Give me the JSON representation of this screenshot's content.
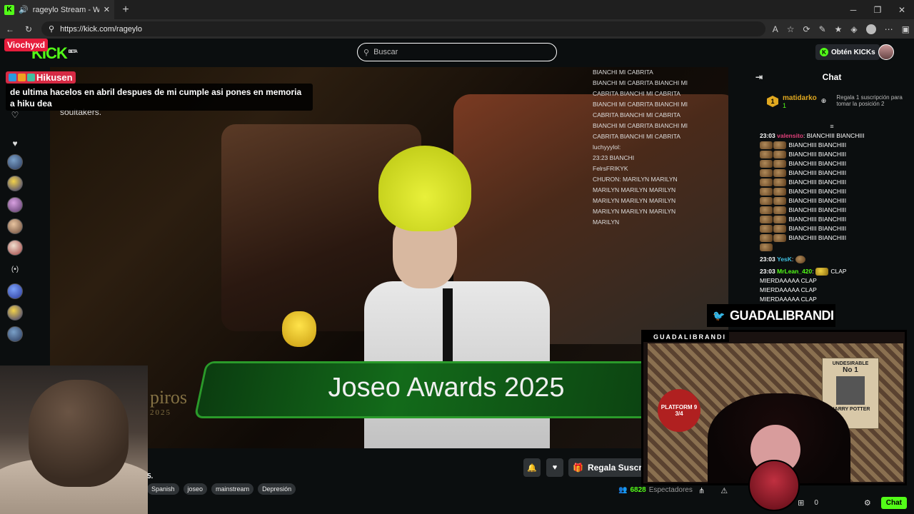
{
  "browser": {
    "tab_title": "rageylo Stream - Watch Live o",
    "url": "https://kick.com/rageylo",
    "new_tab": "+",
    "favicon": "K"
  },
  "header": {
    "logo": "KICK",
    "logo_badge": "BETA",
    "search_placeholder": "Buscar",
    "kicks_button": "Obtén KICKs"
  },
  "overlay": {
    "user1": "Viochyxd",
    "user2": "Hikusen",
    "message": "de ultima hacelos en abril despues de mi cumple asi pones en memoria a hiku dea",
    "soultakers": "soultakers.",
    "banner": "Joseo Awards 2025",
    "award_bg": "piros",
    "award_year": "2025",
    "twitter_handle": "GUADALIBRANDI",
    "facecam_label": "GUADALIBRANDI",
    "poster_title": "UNDESIRABLE",
    "poster_no": "No 1",
    "poster_name": "HARRY POTTER",
    "platform": "PLATFORM 9 3/4",
    "chat_lines": [
      "BIANCHI MI CABRITA",
      "BIANCHI MI CABRITA BIANCHI MI",
      "CABRITA BIANCHI MI CABRITA",
      "BIANCHI MI CABRITA BIANCHI MI",
      "CABRITA BIANCHI MI CABRITA",
      "BIANCHI MI CABRITA BIANCHI MI",
      "CABRITA BIANCHI MI CABRITA",
      "luchyyylol:",
      "23:23 BIANCHI",
      "",
      "",
      "FelrsFRIKYK",
      "CHURON: MARILYN MARILYN",
      "MARILYN MARILYN MARILYN",
      "MARILYN MARILYN MARILYN",
      "MARILYN MARILYN MARILYN",
      "MARILYN"
    ]
  },
  "stream": {
    "title_tail": "5.",
    "tags": [
      "Spanish",
      "joseo",
      "mainstream",
      "Depresión"
    ],
    "gift_button": "Regala Suscrip",
    "viewers_count": "6828",
    "viewers_label": "Espectadores"
  },
  "chat": {
    "title": "Chat",
    "pinned_user": "matidarko",
    "pinned_rank": "1",
    "pinned_count": "1",
    "pinned_gift": "Regala 1 suscripción para tomar la posición 2",
    "messages": [
      {
        "time": "23:03",
        "user": "valensito",
        "text": "BIANCHIII BIANCHIII"
      },
      {
        "time": "",
        "user": "",
        "text": "BIANCHIII BIANCHIII"
      },
      {
        "time": "",
        "user": "",
        "text": "BIANCHIII BIANCHIII"
      },
      {
        "time": "",
        "user": "",
        "text": "BIANCHIII BIANCHIII"
      },
      {
        "time": "",
        "user": "",
        "text": "BIANCHIII BIANCHIII"
      },
      {
        "time": "",
        "user": "",
        "text": "BIANCHIII BIANCHIII"
      },
      {
        "time": "",
        "user": "",
        "text": "BIANCHIII BIANCHIII"
      },
      {
        "time": "",
        "user": "",
        "text": "BIANCHIII BIANCHIII"
      },
      {
        "time": "",
        "user": "",
        "text": "BIANCHIII BIANCHIII"
      },
      {
        "time": "",
        "user": "",
        "text": "BIANCHIII BIANCHIII"
      },
      {
        "time": "",
        "user": "",
        "text": "BIANCHIII BIANCHIII"
      },
      {
        "time": "",
        "user": "",
        "text": "BIANCHIII BIANCHIII"
      }
    ],
    "msg2_time": "23:03",
    "msg2_user": "YesK",
    "msg3_time": "23:03",
    "msg3_user": "MrLean_420",
    "msg3_lines": [
      "CLAP",
      "MIERDAAAAA CLAP",
      "MIERDAAAAA CLAP",
      "MIERDAAAAA CLAP"
    ],
    "footer_count": "0",
    "chat_button": "Chat"
  },
  "colors": {
    "kick_green": "#53fc18",
    "background": "#0b0e0f"
  }
}
